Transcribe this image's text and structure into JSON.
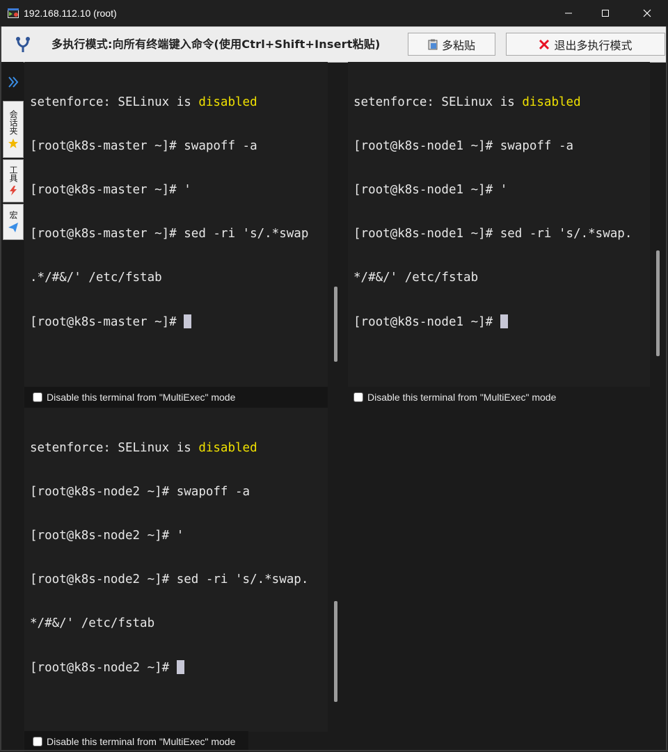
{
  "window": {
    "title": "192.168.112.10 (root)",
    "icons": {
      "app": "mobaxterm-app-icon",
      "minimize": "minimize-icon",
      "maximize": "maximize-icon",
      "close": "close-icon"
    }
  },
  "multiexec_bar": {
    "label": "多执行模式:向所有终端键入命令(使用Ctrl+Shift+Insert粘贴)",
    "paste_button": "多粘贴",
    "exit_button": "退出多执行模式",
    "icons": {
      "mode": "fork-icon",
      "paste": "clipboard-icon",
      "exit": "red-x-icon"
    }
  },
  "sidebar": {
    "tabs": [
      {
        "label": "会话夹",
        "icon": "star-icon"
      },
      {
        "label": "工具",
        "icon": "tools-icon"
      },
      {
        "label": "宏",
        "icon": "send-icon"
      }
    ],
    "expand_icon": "double-chevron-right-icon"
  },
  "terminals": [
    {
      "host": "k8s-master",
      "lines": {
        "l1_prefix": "setenforce: SELinux is ",
        "l1_highlight": "disabled",
        "l2": "[root@k8s-master ~]# swapoff -a",
        "l3": "[root@k8s-master ~]# '",
        "l4": "[root@k8s-master ~]# sed -ri 's/.*swap",
        "l5": ".*/#&/' /etc/fstab",
        "l6": "[root@k8s-master ~]# "
      },
      "disable_label": "Disable this terminal from \"MultiExec\" mode"
    },
    {
      "host": "k8s-node1",
      "lines": {
        "l1_prefix": "setenforce: SELinux is ",
        "l1_highlight": "disabled",
        "l2": "[root@k8s-node1 ~]# swapoff -a",
        "l3": "[root@k8s-node1 ~]# '",
        "l4": "[root@k8s-node1 ~]# sed -ri 's/.*swap.",
        "l5": "*/#&/' /etc/fstab",
        "l6": "[root@k8s-node1 ~]# "
      },
      "disable_label": "Disable this terminal from \"MultiExec\" mode"
    },
    {
      "host": "k8s-node2",
      "lines": {
        "l1_prefix": "setenforce: SELinux is ",
        "l1_highlight": "disabled",
        "l2": "[root@k8s-node2 ~]# swapoff -a",
        "l3": "[root@k8s-node2 ~]# '",
        "l4": "[root@k8s-node2 ~]# sed -ri 's/.*swap.",
        "l5": "*/#&/' /etc/fstab",
        "l6": "[root@k8s-node2 ~]# "
      },
      "disable_label": "Disable this terminal from \"MultiExec\" mode"
    }
  ],
  "colors": {
    "highlight_yellow": "#f0e100",
    "terminal_bg": "#1f1f1f",
    "terminal_fg": "#e8e8e8",
    "close_red": "#e81123"
  }
}
